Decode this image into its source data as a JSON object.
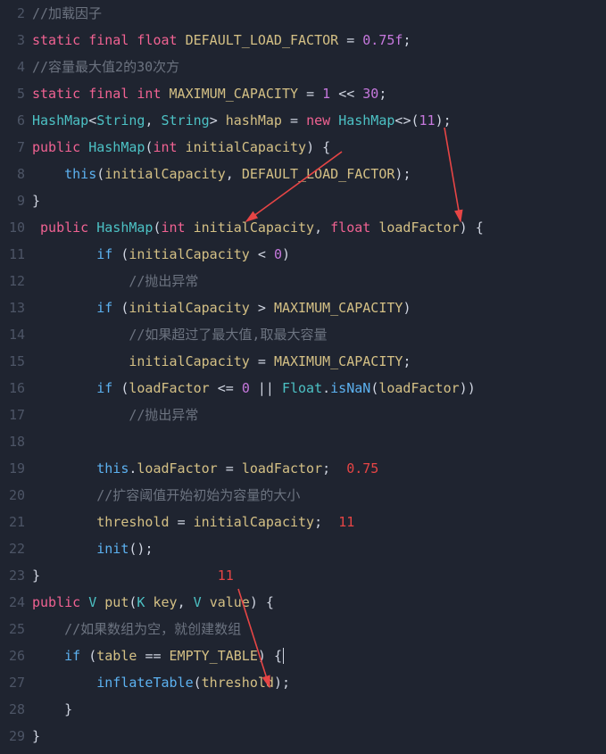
{
  "lines": {
    "ln2": "2",
    "ln3": "3",
    "ln4": "4",
    "ln5": "5",
    "ln6": "6",
    "ln7": "7",
    "ln8": "8",
    "ln9": "9",
    "ln10": "10",
    "ln11": "11",
    "ln12": "12",
    "ln13": "13",
    "ln14": "14",
    "ln15": "15",
    "ln16": "16",
    "ln17": "17",
    "ln18": "18",
    "ln19": "19",
    "ln20": "20",
    "ln21": "21",
    "ln22": "22",
    "ln23": "23",
    "ln24": "24",
    "ln25": "25",
    "ln26": "26",
    "ln27": "27",
    "ln28": "28",
    "ln29": "29"
  },
  "t": {
    "comment_load": "//加载因子",
    "static1": "static",
    "final1": "final",
    "float1": "float",
    "DEFAULT_LOAD_FACTOR_decl": "DEFAULT_LOAD_FACTOR",
    "eq": "=",
    "val075f": "0.75f",
    "semi": ";",
    "comment_cap": "//容量最大值2的30次方",
    "int1": "int",
    "MAXIMUM_CAPACITY_decl": "MAXIMUM_CAPACITY",
    "one": "1",
    "shl": "<<",
    "thirty": "30",
    "HashMap": "HashMap",
    "String": "String",
    "lt": "<",
    "gt": ">",
    "comma": ",",
    "sp": " ",
    "hashMap_var": "hashMap",
    "new": "new",
    "eleven": "11",
    "public": "public",
    "lp": "(",
    "rp": ")",
    "lb": "{",
    "rb": "}",
    "initialCapacity": "initialCapacity",
    "loadFactor": "loadFactor",
    "this": "this",
    "dot": ".",
    "DEFAULT_LOAD_FACTOR_use": "DEFAULT_LOAD_FACTOR",
    "if": "if",
    "ltop": "<",
    "zero": "0",
    "comment_throw1": "//抛出异常",
    "gtop": ">",
    "MAXIMUM_CAPACITY_use": "MAXIMUM_CAPACITY",
    "comment_maxcap": "//如果超过了最大值,取最大容量",
    "leop": "<=",
    "orop": "||",
    "Float": "Float",
    "isNaN": "isNaN",
    "comment_throw2": "//抛出异常",
    "ann075": "0.75",
    "comment_thresh": "//扩容阈值开始初始为容量的大小",
    "threshold": "threshold",
    "ann11a": "11",
    "init": "init",
    "ann11b": "11",
    "V": "V",
    "put": "put",
    "K": "K",
    "key": "key",
    "value": "value",
    "comment_empty": "//如果数组为空，就创建数组",
    "table": "table",
    "eqeq": "==",
    "EMPTY_TABLE": "EMPTY_TABLE",
    "inflateTable": "inflateTable"
  }
}
